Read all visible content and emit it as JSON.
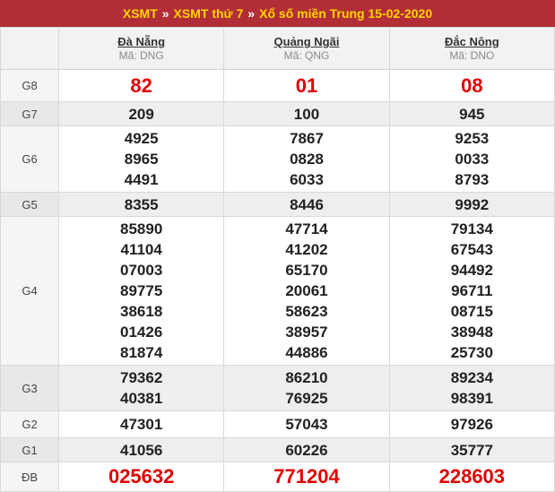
{
  "breadcrumb": {
    "items": [
      "XSMT",
      "XSMT thứ 7",
      "Xổ số miền Trung 15-02-2020"
    ],
    "separator": "»"
  },
  "provinces": [
    {
      "name": "Đà Nẵng",
      "code": "Mã: DNG"
    },
    {
      "name": "Quảng Ngãi",
      "code": "Mã: QNG"
    },
    {
      "name": "Đắc Nông",
      "code": "Mã: DNO"
    }
  ],
  "prizes": {
    "g8": {
      "label": "G8",
      "values": [
        [
          "82"
        ],
        [
          "01"
        ],
        [
          "08"
        ]
      ]
    },
    "g7": {
      "label": "G7",
      "values": [
        [
          "209"
        ],
        [
          "100"
        ],
        [
          "945"
        ]
      ]
    },
    "g6": {
      "label": "G6",
      "values": [
        [
          "4925",
          "8965",
          "4491"
        ],
        [
          "7867",
          "0828",
          "6033"
        ],
        [
          "9253",
          "0033",
          "8793"
        ]
      ]
    },
    "g5": {
      "label": "G5",
      "values": [
        [
          "8355"
        ],
        [
          "8446"
        ],
        [
          "9992"
        ]
      ]
    },
    "g4": {
      "label": "G4",
      "values": [
        [
          "85890",
          "41104",
          "07003",
          "89775",
          "38618",
          "01426",
          "81874"
        ],
        [
          "47714",
          "41202",
          "65170",
          "20061",
          "58623",
          "38957",
          "44886"
        ],
        [
          "79134",
          "67543",
          "94492",
          "96711",
          "08715",
          "38948",
          "25730"
        ]
      ]
    },
    "g3": {
      "label": "G3",
      "values": [
        [
          "79362",
          "40381"
        ],
        [
          "86210",
          "76925"
        ],
        [
          "89234",
          "98391"
        ]
      ]
    },
    "g2": {
      "label": "G2",
      "values": [
        [
          "47301"
        ],
        [
          "57043"
        ],
        [
          "97926"
        ]
      ]
    },
    "g1": {
      "label": "G1",
      "values": [
        [
          "41056"
        ],
        [
          "60226"
        ],
        [
          "35777"
        ]
      ]
    },
    "db": {
      "label": "ĐB",
      "values": [
        [
          "025632"
        ],
        [
          "771204"
        ],
        [
          "228603"
        ]
      ]
    }
  },
  "colors": {
    "title_bg": "#b22e37",
    "title_text": "#ffd400",
    "highlight": "#e00000"
  }
}
